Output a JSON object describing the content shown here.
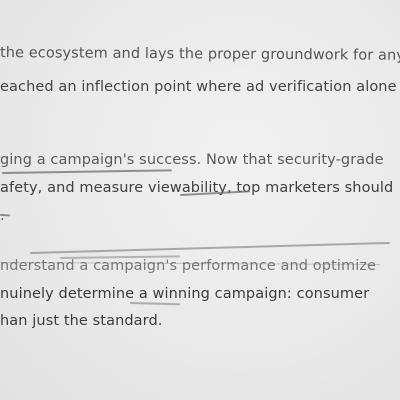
{
  "document": {
    "lines": [
      "the ecosystem and lays the proper groundwork for any",
      "eached an inflection point where ad verification alone",
      "ging a campaign's success. Now that security-grade",
      "afety, and measure viewability, top marketers should",
      ".",
      "nderstand a campaign's performance and optimize",
      "nuinely determine a winning campaign: consumer",
      "han just the standard."
    ]
  }
}
